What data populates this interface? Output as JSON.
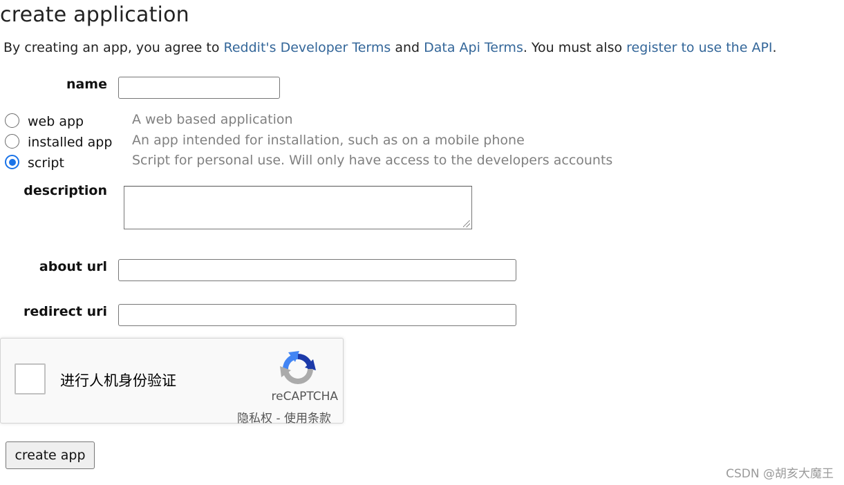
{
  "page": {
    "title": "create application"
  },
  "terms": {
    "prefix": "By creating an app, you agree to ",
    "link1": "Reddit's Developer Terms",
    "and": " and ",
    "link2": "Data Api Terms",
    "middle": ". You must also ",
    "link3": "register to use the API",
    "suffix": "."
  },
  "form": {
    "name_label": "name",
    "name_value": "",
    "app_types": [
      {
        "label": "web app",
        "description": "A web based application",
        "checked": false
      },
      {
        "label": "installed app",
        "description": "An app intended for installation, such as on a mobile phone",
        "checked": false
      },
      {
        "label": "script",
        "description": "Script for personal use. Will only have access to the developers accounts",
        "checked": true
      }
    ],
    "description_label": "description",
    "description_value": "",
    "about_url_label": "about url",
    "about_url_value": "",
    "redirect_uri_label": "redirect uri",
    "redirect_uri_value": ""
  },
  "captcha": {
    "prompt": "进行人机身份验证",
    "brand": "reCAPTCHA",
    "links": "隐私权 - 使用条款",
    "colors": {
      "blue": "#1c3aa9",
      "light_blue": "#4285f4",
      "gray": "#ababab"
    }
  },
  "submit": {
    "label": "create app"
  },
  "watermark": {
    "text": "CSDN @胡亥大魔王"
  },
  "colors": {
    "link": "#336699",
    "radio_accent": "#1a73e8",
    "description_text": "#808080"
  }
}
